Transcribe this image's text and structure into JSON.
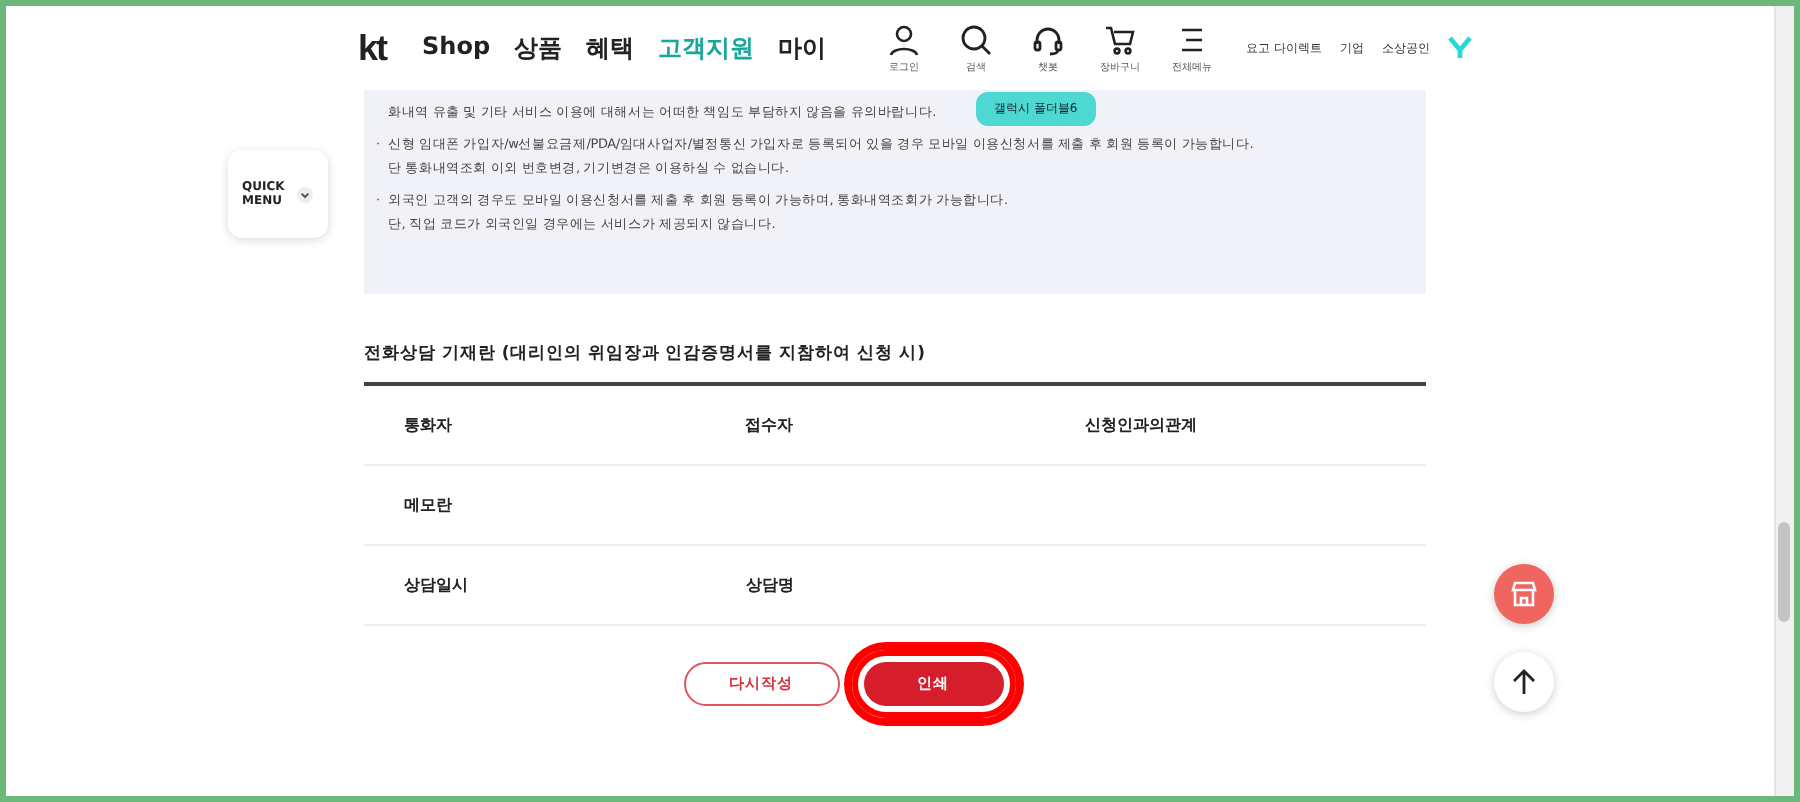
{
  "header": {
    "logo": "kt",
    "nav": [
      {
        "label": "Shop",
        "selected": false
      },
      {
        "label": "상품",
        "selected": false
      },
      {
        "label": "혜택",
        "selected": false
      },
      {
        "label": "고객지원",
        "selected": true
      },
      {
        "label": "마이",
        "selected": false
      }
    ],
    "icons": [
      {
        "kind": "person",
        "label": "로그인"
      },
      {
        "kind": "search",
        "label": "검색"
      },
      {
        "kind": "headset",
        "label": "챗봇"
      },
      {
        "kind": "cart",
        "label": "장바구니"
      },
      {
        "kind": "menu",
        "label": "전체메뉴"
      }
    ],
    "links": [
      "요고 다이렉트",
      "기업",
      "소상공인"
    ],
    "tooltip": "갤럭시 폴더블6"
  },
  "quick_menu": {
    "label": "QUICK MENU"
  },
  "notice": [
    {
      "text": "화내역 유출 및 기타 서비스 이용에 대해서는 어떠한 책임도 부담하지 않음을 유의바랍니다."
    },
    {
      "marker": "·",
      "text": "신형 임대폰 가입자/w선불요금제/PDA/임대사업자/별정통신 가입자로 등록되어 있을 경우 모바일 이용신청서를 제출 후 회원 등록이 가능합니다.\n단 통화내역조회 이외 번호변경, 기기변경은 이용하실 수 없습니다."
    },
    {
      "marker": "·",
      "text": "외국인 고객의 경우도 모바일 이용신청서를 제출 후 회원 등록이 가능하며, 통화내역조회가 가능합니다.\n단, 직업 코드가 외국인일 경우에는 서비스가 제공되지 않습니다."
    }
  ],
  "section": {
    "title": "전화상담 기재란 (대리인의 위임장과 인감증명서를 지참하여 신청 시)",
    "rows": [
      [
        "통화자",
        "접수자",
        "신청인과의관계"
      ],
      [
        "메모란"
      ],
      [
        "상담일시",
        "상담명"
      ]
    ]
  },
  "buttons": [
    {
      "label": "다시작성",
      "kind": "outline",
      "highlighted": false
    },
    {
      "label": "인쇄",
      "kind": "filled",
      "highlighted": true
    }
  ]
}
